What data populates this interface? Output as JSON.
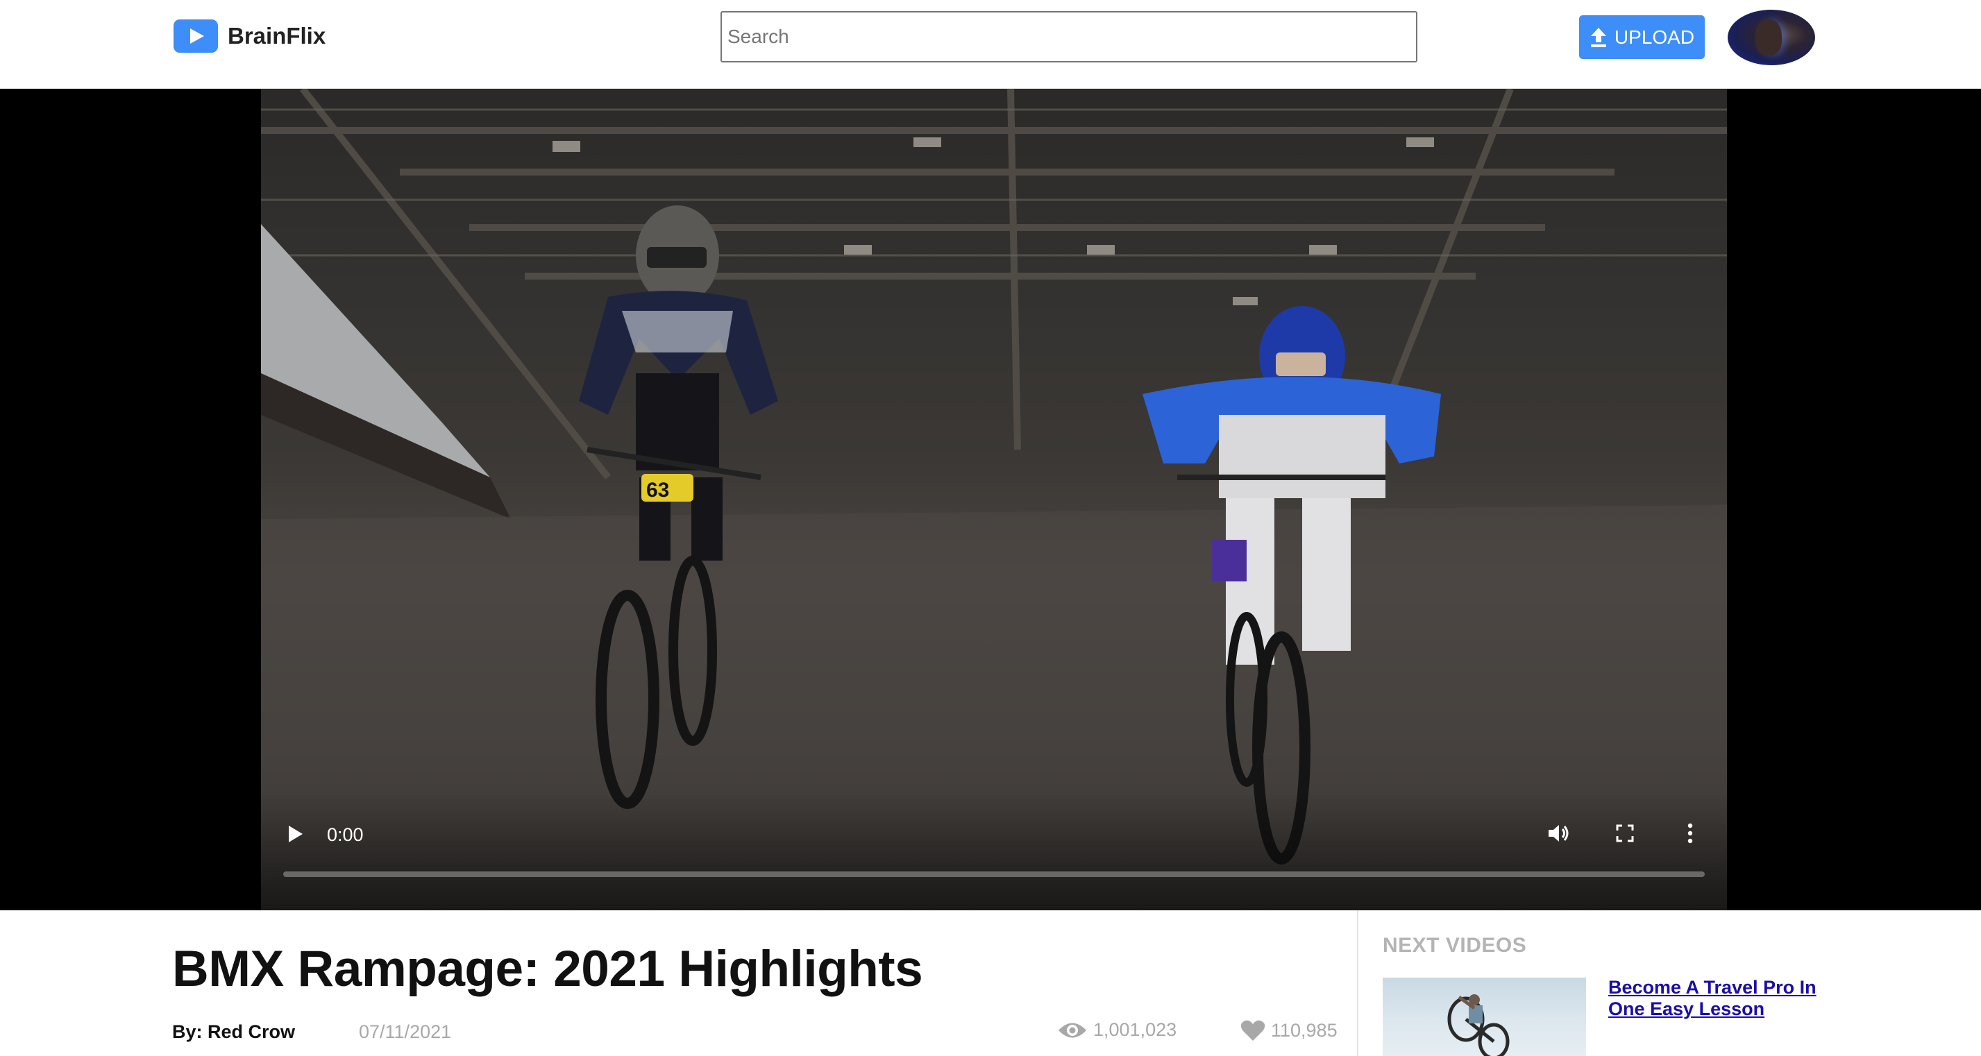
{
  "app": {
    "name": "BrainFlix"
  },
  "search": {
    "placeholder": "Search"
  },
  "header": {
    "upload_label": "UPLOAD"
  },
  "player": {
    "current_time": "0:00",
    "progress": 0
  },
  "video": {
    "title": "BMX Rampage: 2021 Highlights",
    "author": "By: Red Crow",
    "date": "07/11/2021",
    "views": "1,001,023",
    "likes": "110,985",
    "plate_number": "63"
  },
  "next_videos": {
    "heading": "NEXT VIDEOS",
    "items": [
      {
        "title": "Become A Travel Pro In One Easy Lesson"
      }
    ]
  },
  "colors": {
    "accent": "#3d8ef8",
    "muted": "#a8a8a8",
    "link": "#1a0dab"
  },
  "icons": [
    "logo-play-icon",
    "upload-icon",
    "play-icon",
    "volume-icon",
    "fullscreen-icon",
    "more-options-icon",
    "eye-icon",
    "heart-icon"
  ]
}
